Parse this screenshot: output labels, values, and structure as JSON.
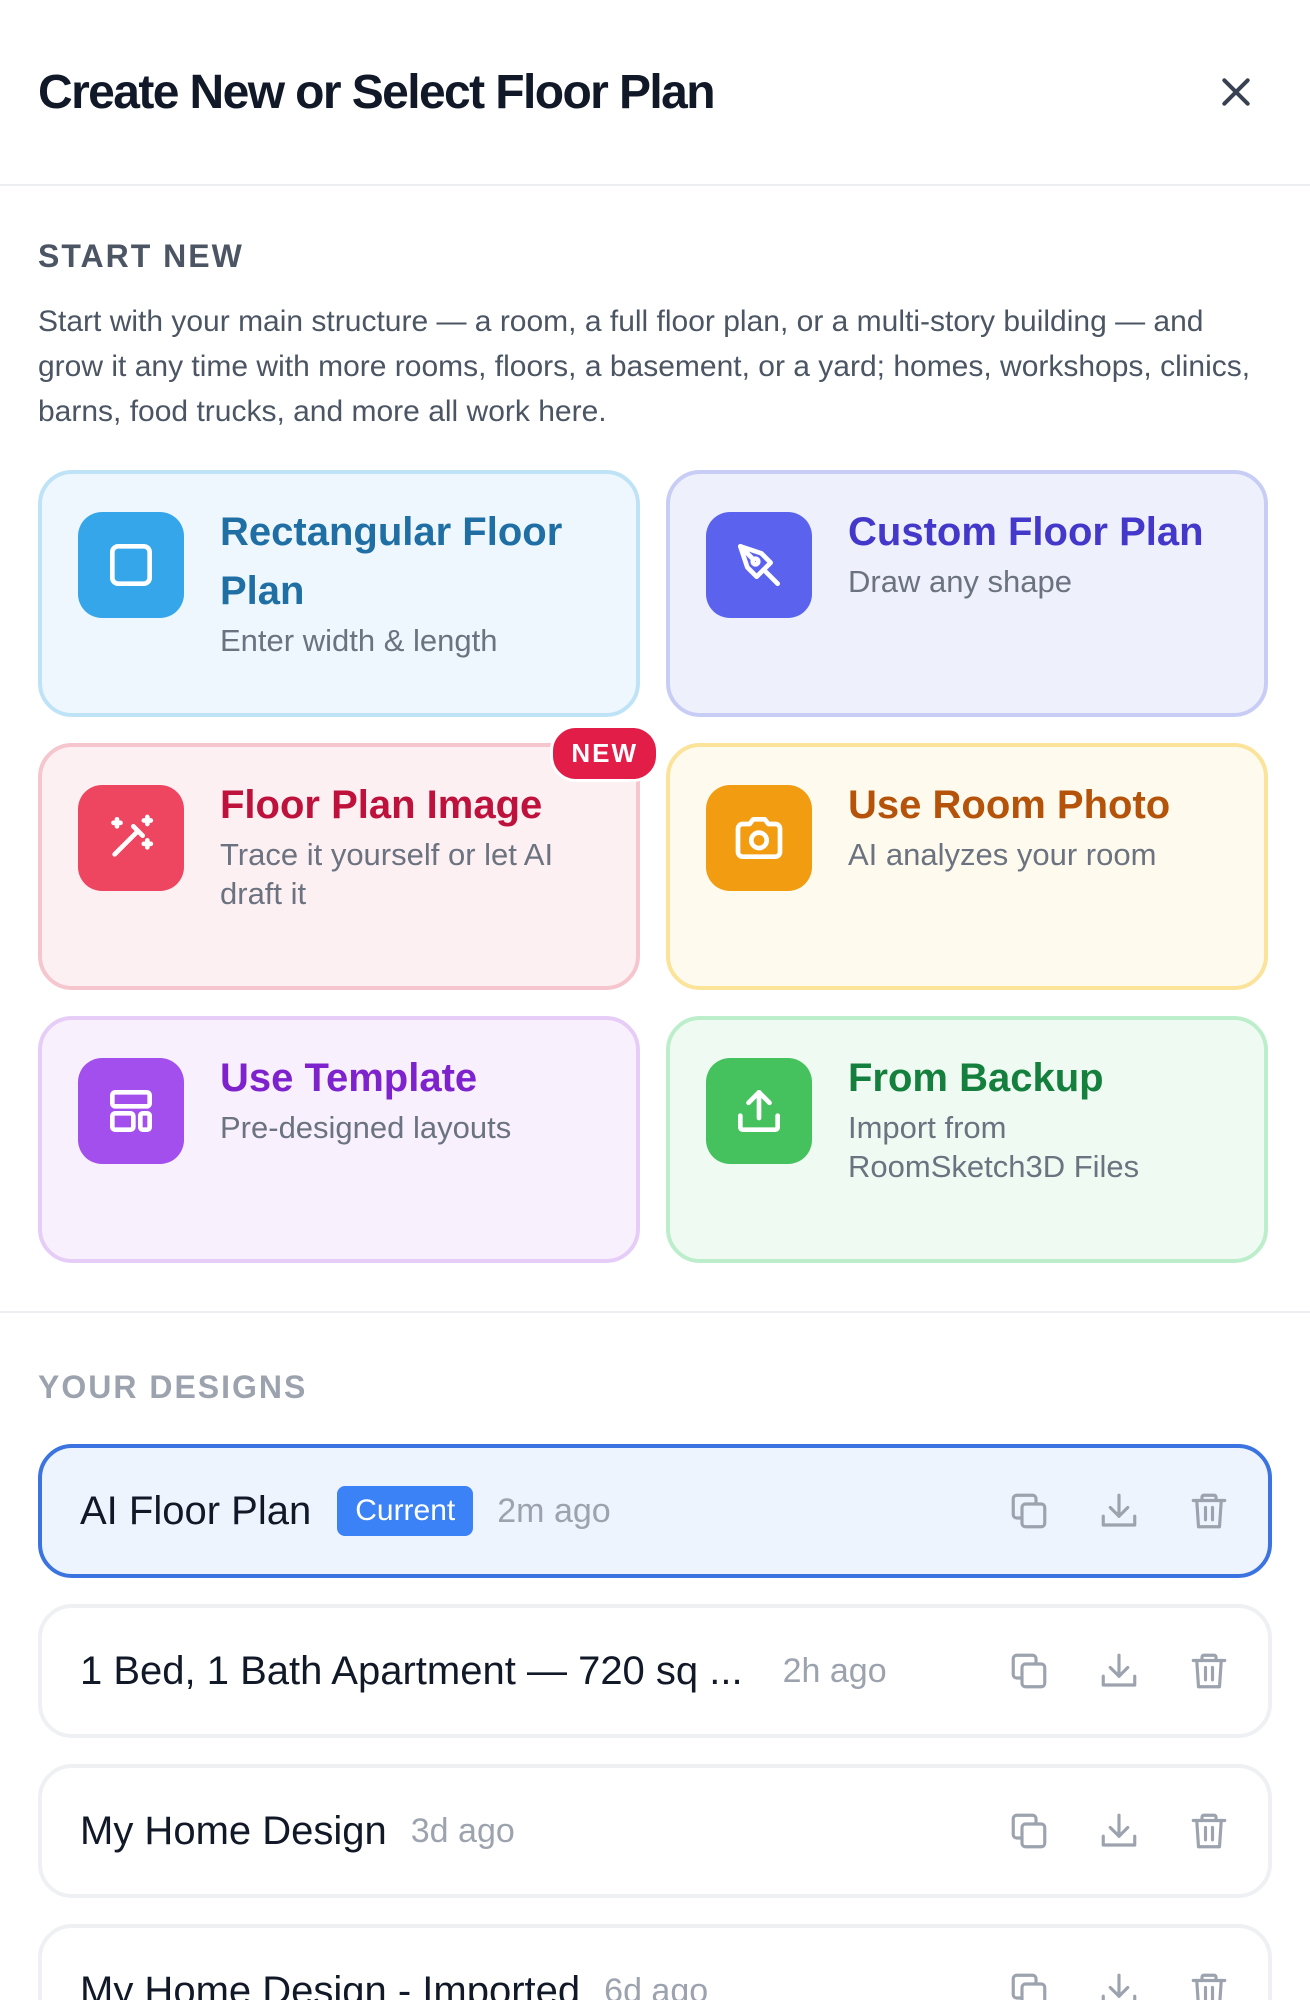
{
  "header": {
    "title": "Create New or Select Floor Plan"
  },
  "start_new": {
    "label": "START NEW",
    "description": "Start with your main structure — a room, a full floor plan, or a multi-story building — and grow it any time with more rooms, floors, a basement, or a yard; homes, workshops, clinics, barns, food trucks, and more all work here.",
    "cards": [
      {
        "title": "Rectangular Floor Plan",
        "subtitle": "Enter width & length",
        "icon": "square-icon",
        "accent": "#1f6fa5"
      },
      {
        "title": "Custom Floor Plan",
        "subtitle": "Draw any shape",
        "icon": "pen-tool-icon",
        "accent": "#4338ca"
      },
      {
        "title": "Floor Plan Image",
        "subtitle": "Trace it yourself or let AI draft it",
        "icon": "magic-wand-icon",
        "accent": "#be123c",
        "badge": "NEW"
      },
      {
        "title": "Use Room Photo",
        "subtitle": "AI analyzes your room",
        "icon": "camera-icon",
        "accent": "#b45309"
      },
      {
        "title": "Use Template",
        "subtitle": "Pre-designed layouts",
        "icon": "layout-template-icon",
        "accent": "#7e22ce"
      },
      {
        "title": "From Backup",
        "subtitle": "Import from RoomSketch3D Files",
        "icon": "upload-icon",
        "accent": "#15803d"
      }
    ]
  },
  "your_designs": {
    "label": "YOUR DESIGNS",
    "current_badge": "Current",
    "items": [
      {
        "name": "AI Floor Plan",
        "time": "2m ago",
        "current": true
      },
      {
        "name": "1 Bed, 1 Bath Apartment — 720 sq ...",
        "time": "2h ago",
        "current": false
      },
      {
        "name": "My Home Design",
        "time": "3d ago",
        "current": false
      },
      {
        "name": "My Home Design - Imported",
        "time": "6d ago",
        "current": false
      }
    ]
  }
}
